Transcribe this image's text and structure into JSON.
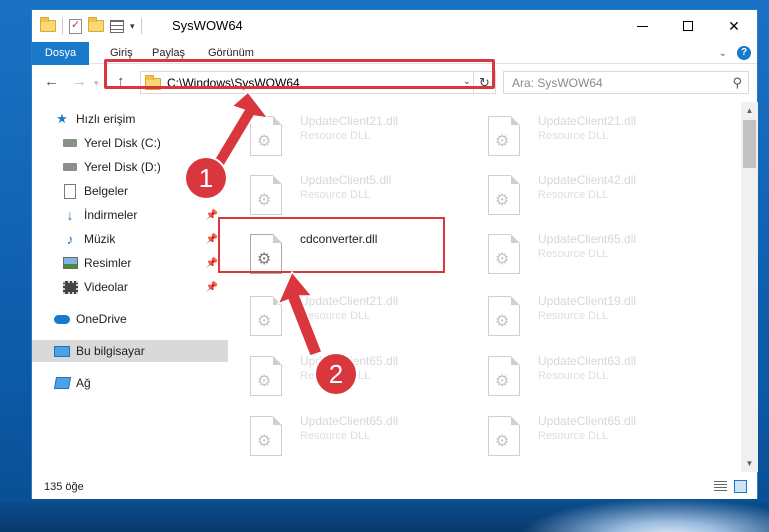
{
  "window": {
    "title": "SysWOW64"
  },
  "ribbon": {
    "tabs": [
      "Dosya",
      "Giriş",
      "Paylaş",
      "Görünüm"
    ]
  },
  "nav": {
    "back": "←",
    "forward": "→",
    "up": "↑",
    "address": "C:\\Windows\\SysWOW64",
    "refresh": "↻",
    "search_placeholder": "Ara: SysWOW64"
  },
  "sidebar": {
    "items": [
      {
        "label": "Hızlı erişim",
        "icon": "star-icon",
        "pinned": false
      },
      {
        "label": "Yerel Disk (C:)",
        "icon": "drive-icon",
        "pinned": false
      },
      {
        "label": "Yerel Disk (D:)",
        "icon": "drive-icon",
        "pinned": false
      },
      {
        "label": "Belgeler",
        "icon": "documents-icon",
        "pinned": true
      },
      {
        "label": "İndirmeler",
        "icon": "downloads-icon",
        "pinned": true
      },
      {
        "label": "Müzik",
        "icon": "music-icon",
        "pinned": true
      },
      {
        "label": "Resimler",
        "icon": "pictures-icon",
        "pinned": true
      },
      {
        "label": "Videolar",
        "icon": "videos-icon",
        "pinned": true
      },
      {
        "label": "OneDrive",
        "icon": "onedrive-icon",
        "pinned": false
      },
      {
        "label": "Bu bilgisayar",
        "icon": "computer-icon",
        "pinned": false,
        "selected": true
      },
      {
        "label": "Ağ",
        "icon": "network-icon",
        "pinned": false
      }
    ]
  },
  "files": [
    {
      "name": "UpdateClient21.dll",
      "type": "Resource DLL"
    },
    {
      "name": "UpdateClient21.dll",
      "type": "Resource DLL"
    },
    {
      "name": "UpdateClient5.dll",
      "type": "Resource DLL"
    },
    {
      "name": "UpdateClient42.dll",
      "type": "Resource DLL"
    },
    {
      "name": "cdconverter.dll",
      "type": ""
    },
    {
      "name": "UpdateClient65.dll",
      "type": "Resource DLL"
    },
    {
      "name": "UpdateClient21.dll",
      "type": "Resource DLL"
    },
    {
      "name": "UpdateClient19.dll",
      "type": "Resource DLL"
    },
    {
      "name": "UpdateClient65.dll",
      "type": "Resource DLL"
    },
    {
      "name": "UpdateClient63.dll",
      "type": "Resource DLL"
    },
    {
      "name": "UpdateClient65.dll",
      "type": "Resource DLL"
    },
    {
      "name": "UpdateClient65.dll",
      "type": "Resource DLL"
    }
  ],
  "status": {
    "item_count": "135 öğe"
  },
  "annotations": {
    "step1": "1",
    "step2": "2",
    "color": "#d9363e"
  }
}
